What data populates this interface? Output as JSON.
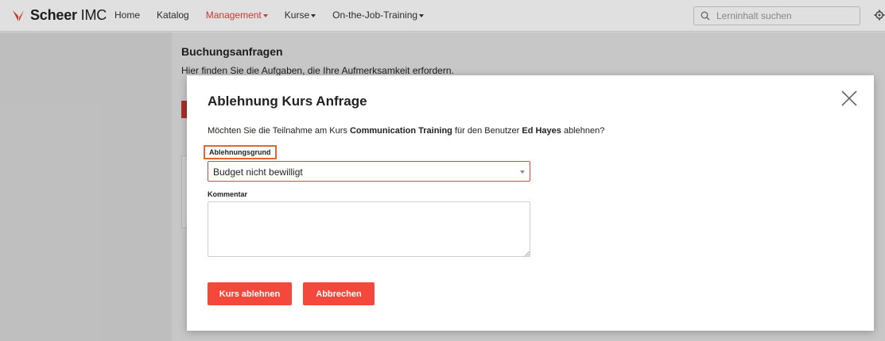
{
  "app": {
    "brand_bold": "Scheer",
    "brand_light": "IMC",
    "brand_color": "#e3443b"
  },
  "nav": {
    "items": [
      {
        "label": "Home",
        "active": false,
        "dropdown": false
      },
      {
        "label": "Katalog",
        "active": false,
        "dropdown": false
      },
      {
        "label": "Management",
        "active": true,
        "dropdown": true
      },
      {
        "label": "Kurse",
        "active": false,
        "dropdown": true
      },
      {
        "label": "On-the-Job-Training",
        "active": false,
        "dropdown": true
      }
    ],
    "search_placeholder": "Lerninhalt suchen"
  },
  "page": {
    "title": "Buchungsanfragen",
    "subtitle": "Hier finden Sie die Aufgaben, die Ihre Aufmerksamkeit erfordern."
  },
  "modal": {
    "title": "Ablehnung Kurs Anfrage",
    "question_prefix": "Möchten Sie die Teilnahme am Kurs ",
    "course": "Communication Training",
    "question_middle": " für den Benutzer ",
    "user": "Ed Hayes",
    "question_suffix": " ablehnen?",
    "reason_label": "Ablehnungsgrund",
    "reason_value": "Budget nicht bewilligt",
    "comment_label": "Kommentar",
    "comment_value": "",
    "reject_button": "Kurs ablehnen",
    "cancel_button": "Abbrechen"
  }
}
